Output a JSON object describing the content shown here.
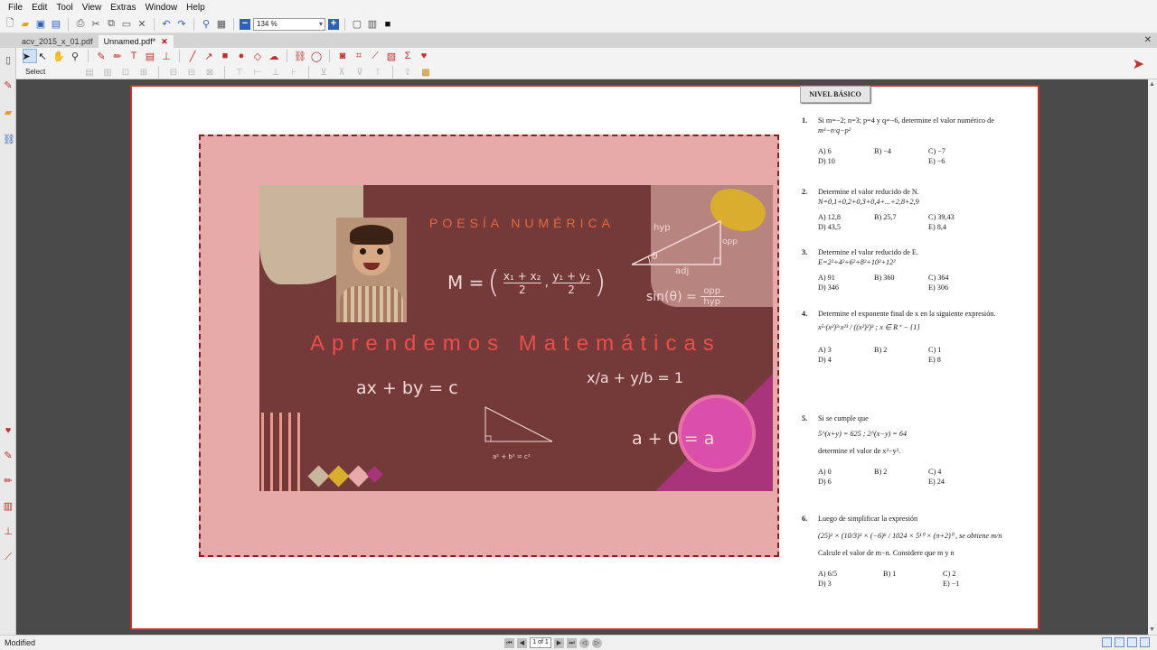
{
  "app": {
    "menu": [
      "File",
      "Edit",
      "Tool",
      "View",
      "Extras",
      "Window",
      "Help"
    ],
    "zoom": "134 %"
  },
  "tabs": [
    {
      "label": "acv_2015_x_01.pdf",
      "active": false
    },
    {
      "label": "Unnamed.pdf*",
      "active": true
    }
  ],
  "toolbar": {
    "select_label": "Select"
  },
  "slide": {
    "poesia": "POESÍA NUMÉRICA",
    "title": "Aprendemos Matemáticas",
    "formula_midpoint_lhs": "M =",
    "formula_midpoint_x": "x₁ + x₂",
    "formula_midpoint_y": "y₁ + y₂",
    "formula_den": "2",
    "sin_formula": "sin(θ) =",
    "sin_num": "opp",
    "sin_den": "hyp",
    "hyp": "hyp",
    "opp": "opp",
    "adj": "adj",
    "theta": "θ",
    "linear": "ax + by = c",
    "intercept": "x/a + y/b = 1",
    "identity": "a + 0 = a",
    "pythag": "a² + b² = c²"
  },
  "exam": {
    "level": "NIVEL BÁSICO",
    "questions": [
      {
        "n": "1.",
        "text": "Si m=−2; n=3; p=4 y q=−6, determine el valor numérico de",
        "math": "m³−n·q−p²",
        "options": [
          "A) 6",
          "B) −4",
          "C) −7",
          "D) 10",
          "",
          "E) −6"
        ]
      },
      {
        "n": "2.",
        "text": "Determine el valor reducido de N.",
        "math": "N=0,1+0,2+0,3+0,4+...+2,8+2,9",
        "options": [
          "A) 12,8",
          "B) 25,7",
          "C) 39,43",
          "D) 43,5",
          "",
          "E) 8,4"
        ]
      },
      {
        "n": "3.",
        "text": "Determine el valor reducido de E.",
        "math": "E=2²+4²+6²+8²+10²+12²",
        "options": [
          "A) 91",
          "B) 360",
          "C) 364",
          "D) 346",
          "",
          "E) 306"
        ]
      },
      {
        "n": "4.",
        "text": "Determine el exponente final de x en la siguiente expresión.",
        "math": "x⁵·(x²)³·x²³ / ((x²)²)³ ; x ∈ R⁺ − {1}",
        "options": [
          "A) 3",
          "B) 2",
          "C) 1",
          "D) 4",
          "",
          "E) 8"
        ]
      },
      {
        "n": "5.",
        "text": "Si se cumple que",
        "math": "5^(x+y) = 625 ; 2^(x−y) = 64",
        "extra": "determine el valor de x²−y².",
        "options": [
          "A) 0",
          "B) 2",
          "C) 4",
          "D) 6",
          "",
          "E) 24"
        ]
      },
      {
        "n": "6.",
        "text": "Luego de simplificar la expresión",
        "math": "(25)² × (10/3)³ × (−6)⁶ / 1024 × 5¹⁰ × (π+2)⁰ , se obtiene m/n",
        "extra": "Calcule el valor de m−n. Considere que m y n",
        "options": [
          "A) 6/5",
          "B) 1",
          "C) 2",
          "D) 3",
          "",
          "E) −1"
        ]
      }
    ]
  },
  "status": {
    "text": "Modified",
    "page_indicator": "1 of 1"
  },
  "colors": {
    "accent_red": "#c8312c",
    "slide_bg": "#743a39",
    "annotation_bg": "#e7aaa8"
  }
}
